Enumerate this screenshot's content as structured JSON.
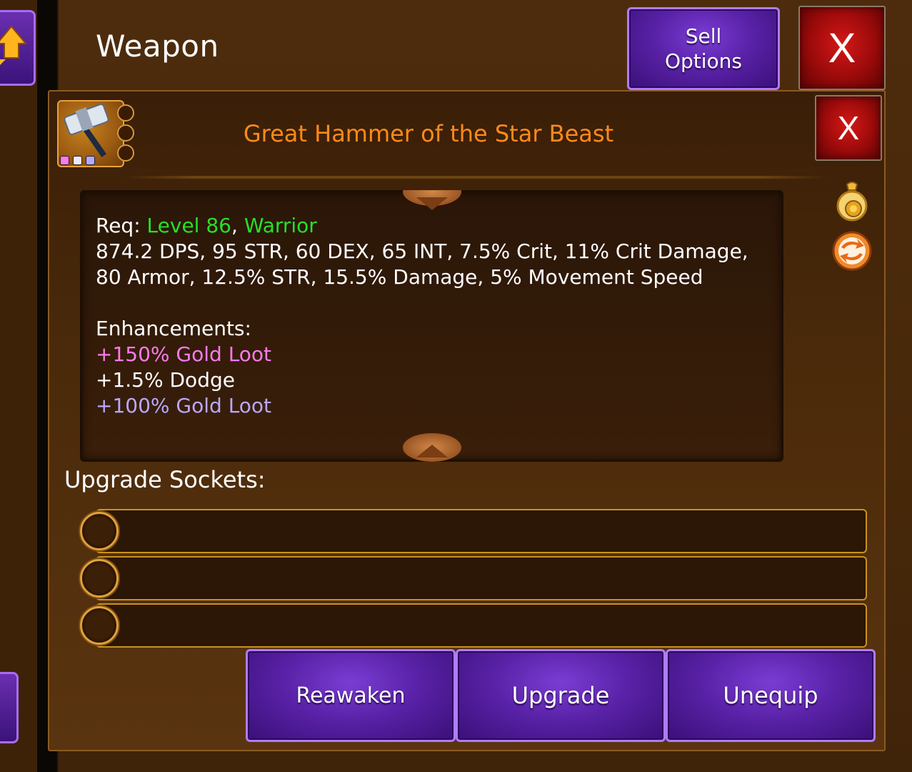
{
  "header": {
    "title": "Weapon",
    "sell_options_label": "Sell\nOptions",
    "close_label": "X"
  },
  "item": {
    "name": "Great Hammer of the Star Beast",
    "close_label": "X",
    "name_color": "#ff8a1a",
    "gem_colors": [
      "#ff7aea",
      "#f0e8ff",
      "#b8a8ff"
    ]
  },
  "stats": {
    "req_label": "Req:",
    "req_level": "Level 86",
    "req_sep": ",",
    "req_class": "Warrior",
    "line": "874.2 DPS, 95 STR, 60 DEX, 65 INT, 7.5% Crit, 11% Crit Damage, 80 Armor, 12.5% STR, 15.5% Damage, 5% Movement Speed",
    "enhancements_title": "Enhancements:",
    "enhancements": [
      {
        "text": "+150% Gold Loot",
        "color": "#ff7aea"
      },
      {
        "text": "+1.5% Dodge",
        "color": "#ffffff"
      },
      {
        "text": "+100% Gold Loot",
        "color": "#b8a8ff"
      }
    ]
  },
  "sockets": {
    "title": "Upgrade Sockets:",
    "count": 3
  },
  "actions": {
    "reawaken": "Reawaken",
    "upgrade": "Upgrade",
    "unequip": "Unequip"
  },
  "icons": [
    "up-arrow-icon",
    "hammer-icon",
    "gold-bag-icon",
    "swap-icon",
    "close-icon"
  ],
  "colors": {
    "accent_purple": "#5a22a8",
    "close_red": "#a00b0b",
    "socket_border": "#c8921e",
    "req_green": "#26e02a"
  }
}
